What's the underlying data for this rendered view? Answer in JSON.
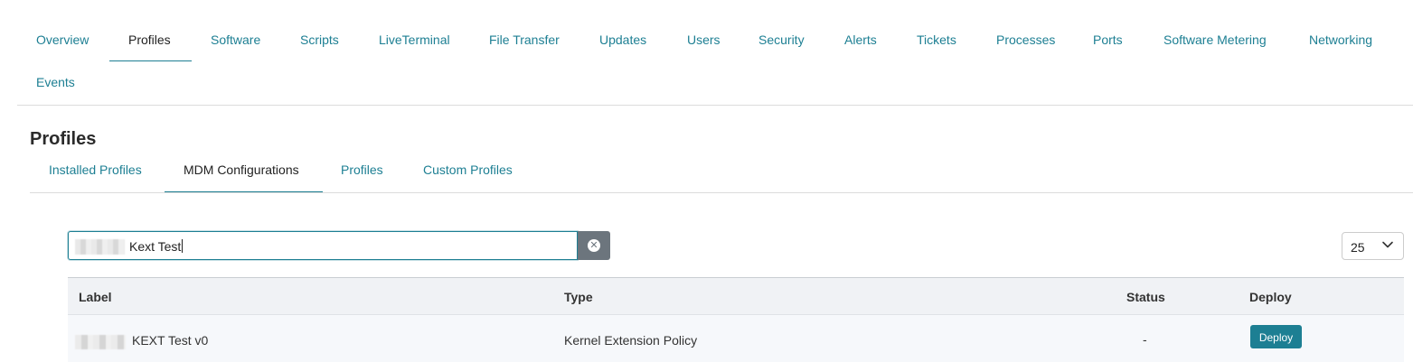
{
  "top_nav": {
    "tabs": [
      "Overview",
      "Profiles",
      "Software",
      "Scripts",
      "LiveTerminal",
      "File Transfer",
      "Updates",
      "Users",
      "Security",
      "Alerts",
      "Tickets",
      "Processes",
      "Ports",
      "Software Metering",
      "Networking",
      "Events"
    ],
    "active": "Profiles"
  },
  "section": {
    "title": "Profiles"
  },
  "sub_nav": {
    "tabs": [
      "Installed Profiles",
      "MDM Configurations",
      "Profiles",
      "Custom Profiles"
    ],
    "active": "MDM Configurations"
  },
  "search": {
    "value": "Kext Test",
    "clear_icon": "x-circle-icon"
  },
  "page_size": {
    "value": "25",
    "icon": "chevron-down-icon"
  },
  "table": {
    "headers": [
      "Label",
      "Type",
      "Status",
      "Deploy"
    ],
    "rows": [
      {
        "label": "KEXT Test v0",
        "type": "Kernel Extension Policy",
        "status": "-",
        "deploy_label": "Deploy"
      }
    ]
  },
  "colors": {
    "accent": "#1d7f93",
    "clear_button": "#6c757d",
    "header_bg": "#f0f2f5"
  }
}
